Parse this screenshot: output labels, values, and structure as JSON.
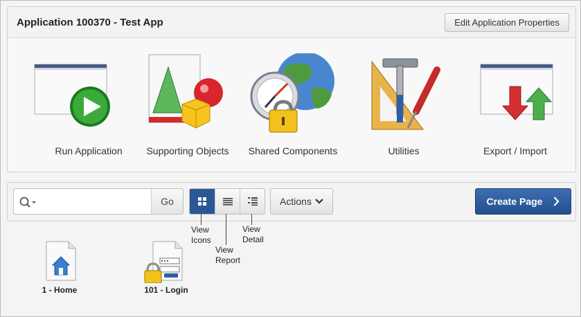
{
  "header": {
    "title": "Application 100370 - Test App",
    "edit_button": "Edit Application Properties"
  },
  "app_icons": [
    {
      "label": "Run Application",
      "icon": "run-application-icon"
    },
    {
      "label": "Supporting Objects",
      "icon": "supporting-objects-icon"
    },
    {
      "label": "Shared Components",
      "icon": "shared-components-icon"
    },
    {
      "label": "Utilities",
      "icon": "utilities-icon"
    },
    {
      "label": "Export / Import",
      "icon": "export-import-icon"
    }
  ],
  "toolbar": {
    "search": {
      "value": "",
      "placeholder": ""
    },
    "go_label": "Go",
    "view_buttons": [
      {
        "name": "view-icons",
        "active": true
      },
      {
        "name": "view-report",
        "active": false
      },
      {
        "name": "view-detail",
        "active": false
      }
    ],
    "actions_label": "Actions",
    "create_label": "Create Page"
  },
  "callouts": {
    "view_icons": [
      "View",
      "Icons"
    ],
    "view_report": [
      "View",
      "Report"
    ],
    "view_detail": [
      "View",
      "Detail"
    ]
  },
  "pages": [
    {
      "label": "1 - Home",
      "icon": "home-page-icon"
    },
    {
      "label": "101 - Login",
      "icon": "login-page-icon"
    }
  ],
  "colors": {
    "accent": "#2c5797",
    "create_button": "#2b5a9b",
    "run_green": "#2f9a2f",
    "export_red": "#d62f2f"
  }
}
